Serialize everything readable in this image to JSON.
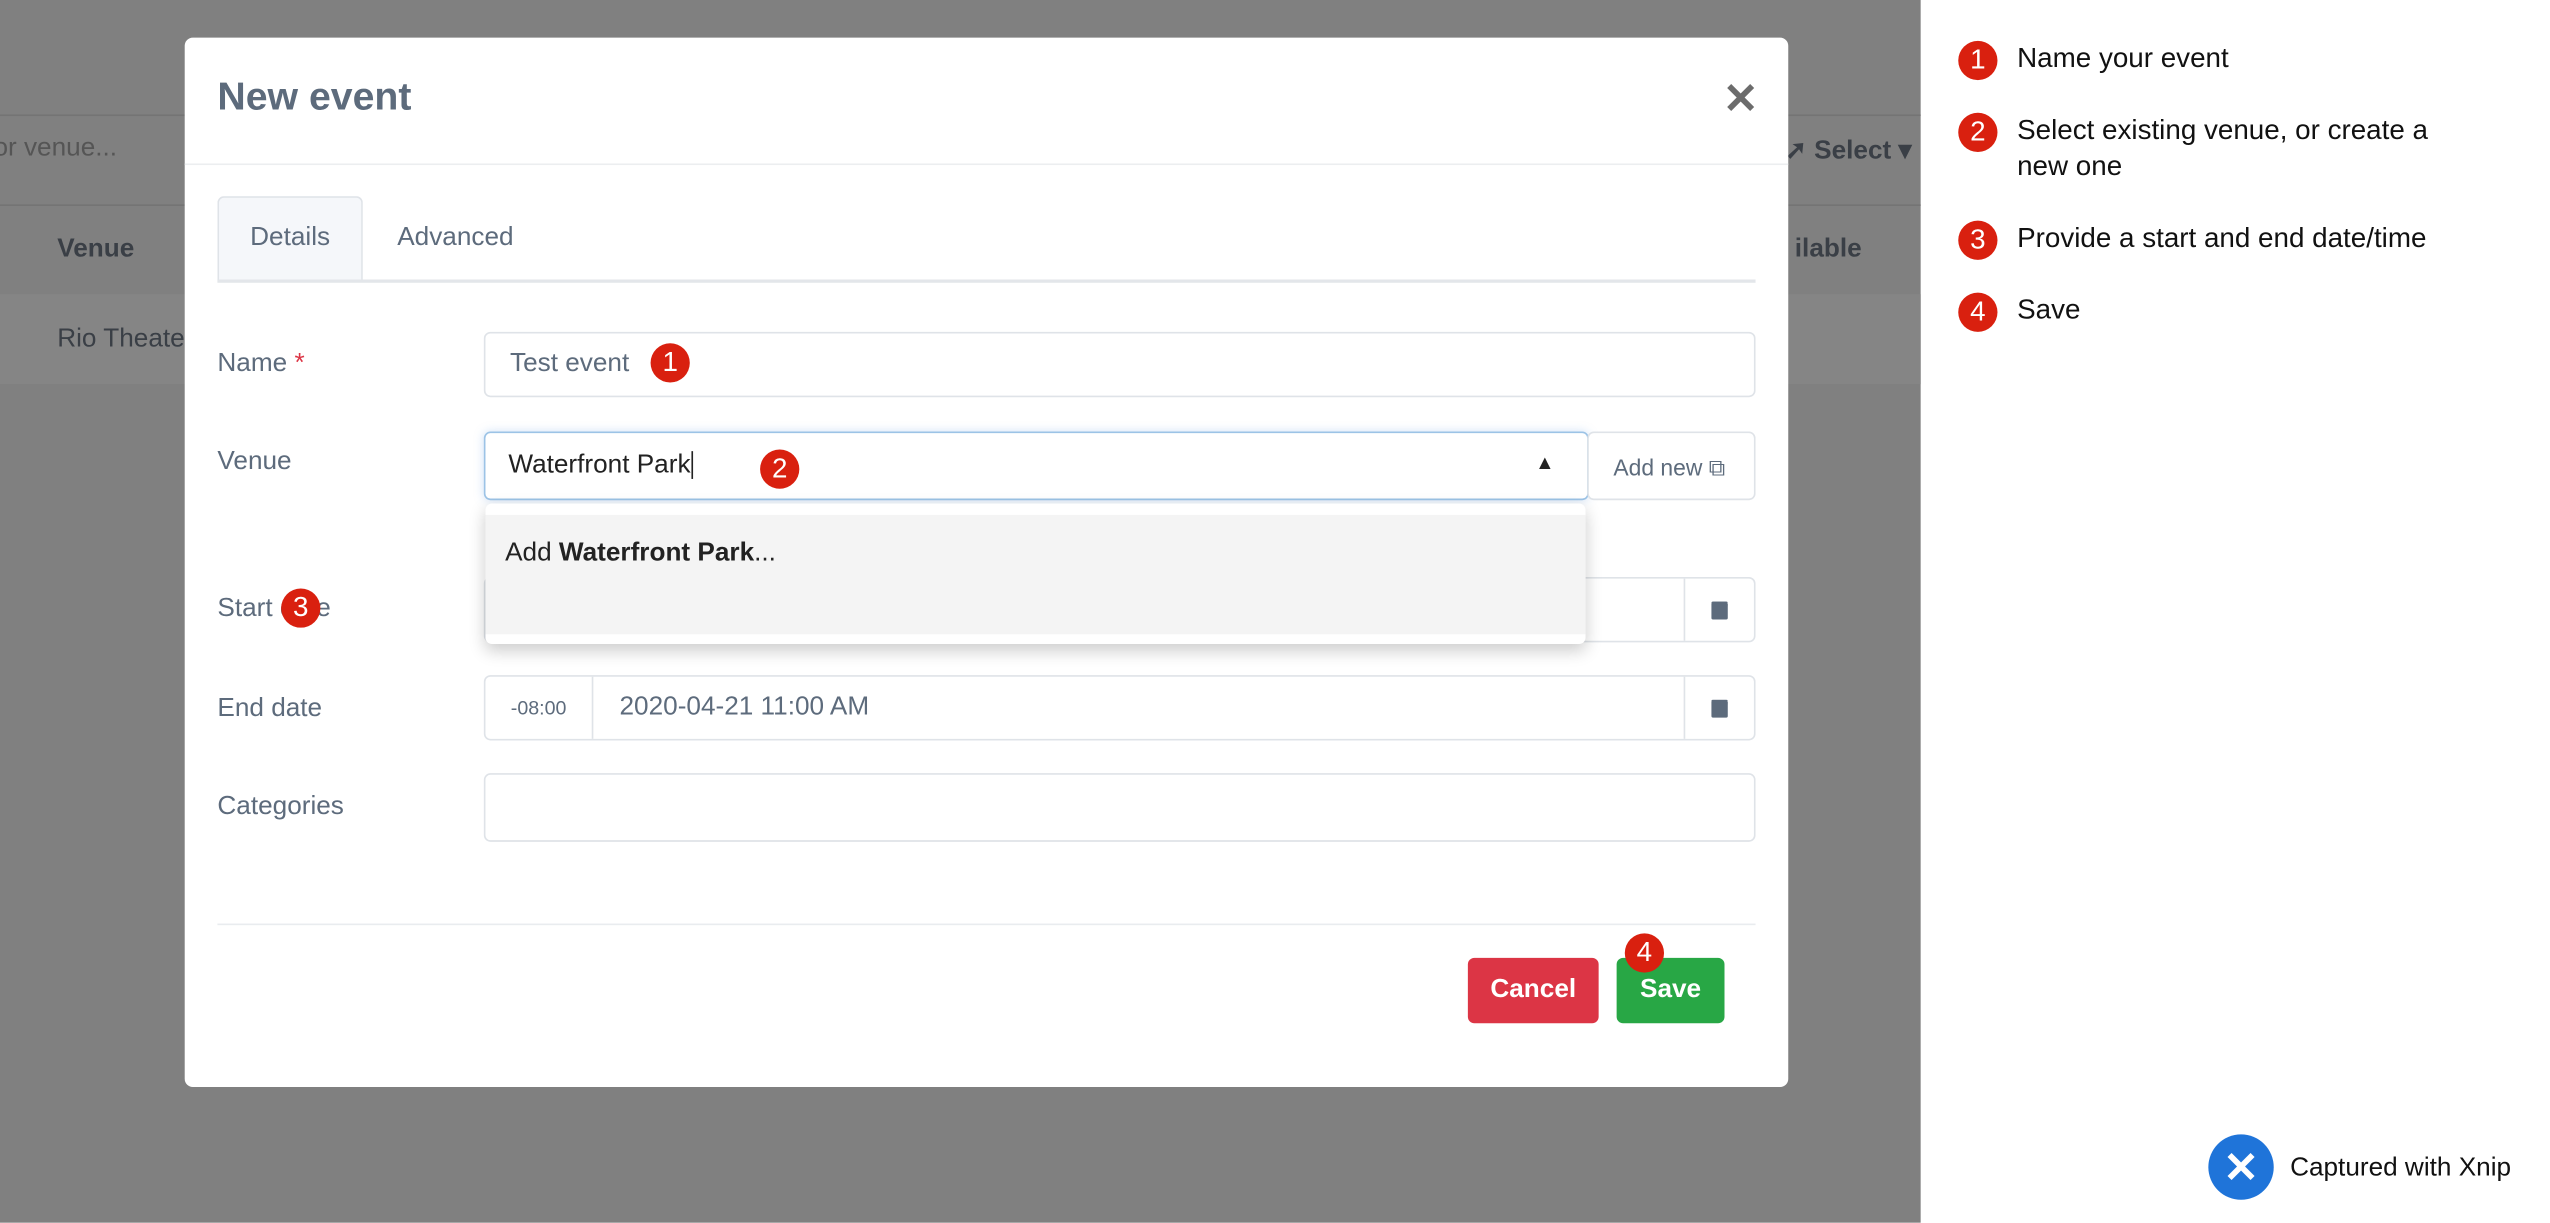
{
  "background": {
    "search_placeholder": "or venue...",
    "select_label": "Select",
    "col_venue": "Venue",
    "col_available": "ilable",
    "row_venue": "Rio Theater"
  },
  "modal": {
    "title": "New event",
    "tabs": [
      {
        "label": "Details",
        "active": true
      },
      {
        "label": "Advanced",
        "active": false
      }
    ],
    "name": {
      "label": "Name",
      "required": "*",
      "value": "Test event"
    },
    "venue": {
      "label": "Venue",
      "value": "Waterfront Park",
      "add_new": "Add new",
      "dropdown_prefix": "Add ",
      "dropdown_bold": "Waterfront Park",
      "dropdown_suffix": "..."
    },
    "start_date": {
      "label": "Start date"
    },
    "end_date": {
      "label": "End date",
      "tz": "-08:00",
      "value": "2020-04-21 11:00 AM"
    },
    "categories": {
      "label": "Categories",
      "value": ""
    },
    "cancel": "Cancel",
    "save": "Save"
  },
  "badges": [
    "1",
    "2",
    "3",
    "4"
  ],
  "steps": [
    {
      "num": "1",
      "text": "Name your event"
    },
    {
      "num": "2",
      "text": "Select existing venue, or create a new one"
    },
    {
      "num": "3",
      "text": "Provide a start and end date/time"
    },
    {
      "num": "4",
      "text": "Save"
    }
  ],
  "watermark": "Captured with Xnip",
  "colors": {
    "badge": "#d9200f",
    "cancel": "#dc3545",
    "save": "#28a745",
    "overlay": "#808080"
  }
}
